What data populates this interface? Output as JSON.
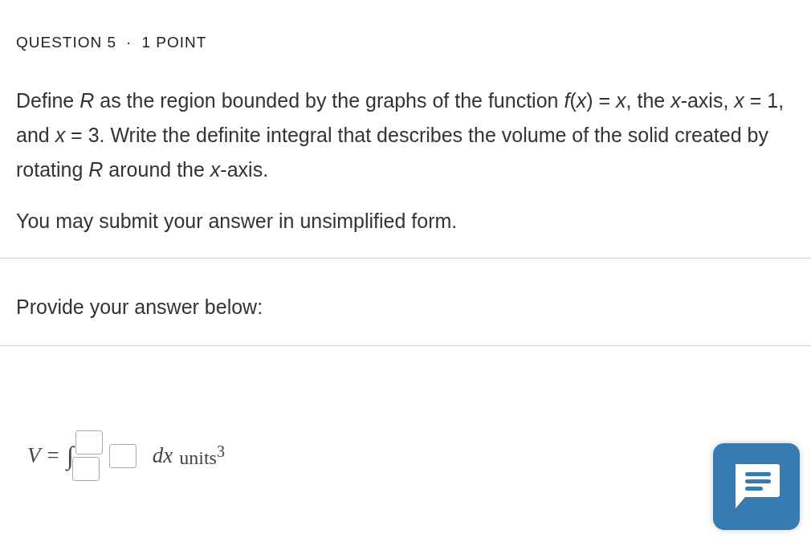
{
  "header": {
    "question": "QUESTION 5",
    "separator": "·",
    "points": "1 POINT"
  },
  "prompt": "Define *R* as the region bounded by the graphs of the function *f*(*x*) = *x*, the *x*-axis, *x* = 1, and *x* = 3. Write the definite integral that describes the volume of the solid created by rotating *R* around the *x*-axis.",
  "note": "You may submit your answer in unsimplified form.",
  "answer_label": "Provide your answer below:",
  "equation": {
    "lhs": "V =",
    "integral": "∫",
    "differential": "dx",
    "unit": "units$^{3}$",
    "fields": [
      {
        "kind": "upper"
      },
      {
        "kind": "lower"
      },
      {
        "kind": "integrand"
      }
    ]
  }
}
